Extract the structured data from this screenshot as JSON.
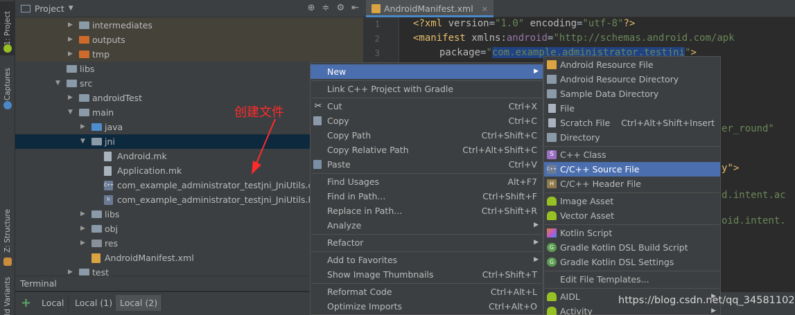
{
  "side_tabs": {
    "project": "1: Project",
    "captures": "Captures",
    "structure": "Z: Structure",
    "variants": "Build Variants"
  },
  "project_panel": {
    "title": "Project",
    "tree": [
      {
        "label": "intermediates",
        "icon": "folder-icon",
        "depth": 3,
        "arrow": "right",
        "style": "excluded"
      },
      {
        "label": "outputs",
        "icon": "folder-orange-icon",
        "depth": 3,
        "arrow": "right",
        "style": "excluded"
      },
      {
        "label": "tmp",
        "icon": "folder-orange-icon",
        "depth": 3,
        "arrow": "right",
        "style": "excluded"
      },
      {
        "label": "libs",
        "icon": "folder-icon",
        "depth": 2,
        "arrow": "none",
        "style": ""
      },
      {
        "label": "src",
        "icon": "folder-icon",
        "depth": 2,
        "arrow": "down",
        "style": ""
      },
      {
        "label": "androidTest",
        "icon": "folder-icon",
        "depth": 3,
        "arrow": "right",
        "style": ""
      },
      {
        "label": "main",
        "icon": "folder-icon",
        "depth": 3,
        "arrow": "down",
        "style": ""
      },
      {
        "label": "java",
        "icon": "folder-blue-icon",
        "depth": 4,
        "arrow": "right",
        "style": ""
      },
      {
        "label": "jni",
        "icon": "folder-icon",
        "depth": 4,
        "arrow": "down",
        "style": "selected"
      },
      {
        "label": "Android.mk",
        "icon": "mk-file-icon",
        "depth": 5,
        "arrow": "none",
        "style": ""
      },
      {
        "label": "Application.mk",
        "icon": "mk-file-icon",
        "depth": 5,
        "arrow": "none",
        "style": ""
      },
      {
        "label": "com_example_administrator_testjni_JniUtils.cpp",
        "icon": "cpp-file-icon",
        "depth": 5,
        "arrow": "none",
        "style": ""
      },
      {
        "label": "com_example_administrator_testjni_JniUtils.h",
        "icon": "h-file-icon",
        "depth": 5,
        "arrow": "none",
        "style": ""
      },
      {
        "label": "libs",
        "icon": "folder-icon",
        "depth": 4,
        "arrow": "right",
        "style": ""
      },
      {
        "label": "obj",
        "icon": "folder-icon",
        "depth": 4,
        "arrow": "right",
        "style": ""
      },
      {
        "label": "res",
        "icon": "folder-res-icon",
        "depth": 4,
        "arrow": "right",
        "style": ""
      },
      {
        "label": "AndroidManifest.xml",
        "icon": "xml-file-icon",
        "depth": 4,
        "arrow": "none",
        "style": ""
      },
      {
        "label": "test",
        "icon": "folder-icon",
        "depth": 3,
        "arrow": "right",
        "style": ""
      }
    ]
  },
  "annotation": {
    "text": "创建文件"
  },
  "terminal": {
    "title": "Terminal",
    "tabs": [
      "Local",
      "Local (1)",
      "Local (2)"
    ],
    "active_tab": "Local (2)"
  },
  "editor": {
    "tab_label": "AndroidManifest.xml",
    "line_numbers": [
      "1",
      "2",
      "3"
    ],
    "line1": {
      "p1": "<?",
      "p2": "xml ",
      "p3": "version",
      "p4": "=",
      "p5": "\"1.0\" ",
      "p6": "encoding",
      "p7": "=",
      "p8": "\"utf-8\"",
      "p9": "?>"
    },
    "line2": {
      "p1": "<manifest ",
      "p2": "xmlns:",
      "p3": "android",
      "p4": "=",
      "p5": "\"http://schemas.android.com/apk"
    },
    "line3": {
      "p1": "package",
      "p2": "=",
      "p3": "\"",
      "p4": "com.example.administrator.testjni",
      "p5": "\"",
      "p6": ">"
    },
    "fragments": [
      "er_round\"",
      "y\">",
      "d.intent.ac",
      "oid.intent."
    ]
  },
  "context_menu": {
    "items": [
      {
        "label": "New",
        "shortcut": "",
        "submenu": true,
        "icon": "",
        "highlighted": true
      },
      {
        "sep": true
      },
      {
        "label": "Link C++ Project with Gradle",
        "shortcut": "",
        "icon": ""
      },
      {
        "sep": true
      },
      {
        "label": "Cut",
        "shortcut": "Ctrl+X",
        "icon": "scissors-icon"
      },
      {
        "label": "Copy",
        "shortcut": "Ctrl+C",
        "icon": "copy-icon"
      },
      {
        "label": "Copy Path",
        "shortcut": "Ctrl+Shift+C",
        "icon": ""
      },
      {
        "label": "Copy Relative Path",
        "shortcut": "Ctrl+Alt+Shift+C",
        "icon": ""
      },
      {
        "label": "Paste",
        "shortcut": "Ctrl+V",
        "icon": "paste-icon"
      },
      {
        "sep": true
      },
      {
        "label": "Find Usages",
        "shortcut": "Alt+F7",
        "icon": ""
      },
      {
        "label": "Find in Path...",
        "shortcut": "Ctrl+Shift+F",
        "icon": ""
      },
      {
        "label": "Replace in Path...",
        "shortcut": "Ctrl+Shift+R",
        "icon": ""
      },
      {
        "label": "Analyze",
        "shortcut": "",
        "submenu": true,
        "icon": ""
      },
      {
        "sep": true
      },
      {
        "label": "Refactor",
        "shortcut": "",
        "submenu": true,
        "icon": ""
      },
      {
        "sep": true
      },
      {
        "label": "Add to Favorites",
        "shortcut": "",
        "submenu": true,
        "icon": ""
      },
      {
        "label": "Show Image Thumbnails",
        "shortcut": "Ctrl+Shift+T",
        "icon": ""
      },
      {
        "sep": true
      },
      {
        "label": "Reformat Code",
        "shortcut": "Ctrl+Alt+L",
        "icon": ""
      },
      {
        "label": "Optimize Imports",
        "shortcut": "Ctrl+Alt+O",
        "icon": ""
      }
    ]
  },
  "new_submenu": {
    "items": [
      {
        "label": "Android Resource File",
        "shortcut": "",
        "icon": "android-resource-icon"
      },
      {
        "label": "Android Resource Directory",
        "shortcut": "",
        "icon": "folder-icon"
      },
      {
        "label": "Sample Data Directory",
        "shortcut": "",
        "icon": "folder-icon"
      },
      {
        "label": "File",
        "shortcut": "",
        "icon": "file-icon"
      },
      {
        "label": "Scratch File",
        "shortcut": "Ctrl+Alt+Shift+Insert",
        "icon": "scratch-file-icon"
      },
      {
        "label": "Directory",
        "shortcut": "",
        "icon": "folder-icon"
      },
      {
        "sep": true
      },
      {
        "label": "C++ Class",
        "shortcut": "",
        "icon": "cpp-class-icon"
      },
      {
        "label": "C/C++ Source File",
        "shortcut": "",
        "icon": "cpp-source-icon",
        "highlighted": true
      },
      {
        "label": "C/C++ Header File",
        "shortcut": "",
        "icon": "cpp-header-icon"
      },
      {
        "sep": true
      },
      {
        "label": "Image Asset",
        "shortcut": "",
        "icon": "android-icon"
      },
      {
        "label": "Vector Asset",
        "shortcut": "",
        "icon": "android-icon"
      },
      {
        "sep": true
      },
      {
        "label": "Kotlin Script",
        "shortcut": "",
        "icon": "kotlin-icon"
      },
      {
        "label": "Gradle Kotlin DSL Build Script",
        "shortcut": "",
        "icon": "gradle-icon"
      },
      {
        "label": "Gradle Kotlin DSL Settings",
        "shortcut": "",
        "icon": "gradle-icon"
      },
      {
        "sep": true
      },
      {
        "label": "Edit File Templates...",
        "shortcut": "",
        "icon": ""
      },
      {
        "sep": true
      },
      {
        "label": "AIDL",
        "shortcut": "",
        "icon": "android-icon",
        "submenu": true
      },
      {
        "label": "Activity",
        "shortcut": "",
        "icon": "android-icon",
        "submenu": true
      }
    ]
  },
  "watermark": {
    "text": "https://blog.csdn.net/qq_34581102"
  },
  "colors": {
    "accent": "#4b6eaf",
    "selection": "#214283",
    "annotation": "#ff2b2b"
  }
}
